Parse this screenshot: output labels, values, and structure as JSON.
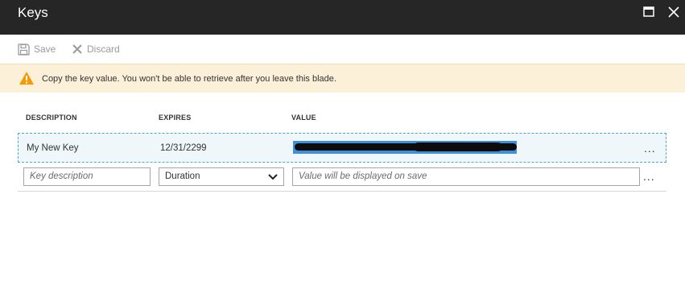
{
  "window": {
    "title": "Keys"
  },
  "toolbar": {
    "save_label": "Save",
    "discard_label": "Discard"
  },
  "banner": {
    "message": "Copy the key value. You won't be able to retrieve after you leave this blade."
  },
  "table": {
    "headers": {
      "description": "DESCRIPTION",
      "expires": "EXPIRES",
      "value": "VALUE"
    },
    "rows": [
      {
        "description": "My New Key",
        "expires": "12/31/2299",
        "value": "",
        "more": "..."
      }
    ],
    "new_row": {
      "description_placeholder": "Key description",
      "duration_selected": "Duration",
      "value_placeholder": "Value will be displayed on save",
      "more": "..."
    }
  },
  "icons": {
    "maximize": "maximize-icon",
    "close": "close-icon",
    "save": "save-icon",
    "discard": "discard-icon",
    "warning": "warning-icon",
    "chevron": "chevron-down-icon"
  },
  "colors": {
    "titlebar": "#262626",
    "banner_bg": "#fcf0d9",
    "warning": "#f59b00",
    "selection": "#3d8fe0",
    "row_highlight_border": "#4aa7d8"
  }
}
